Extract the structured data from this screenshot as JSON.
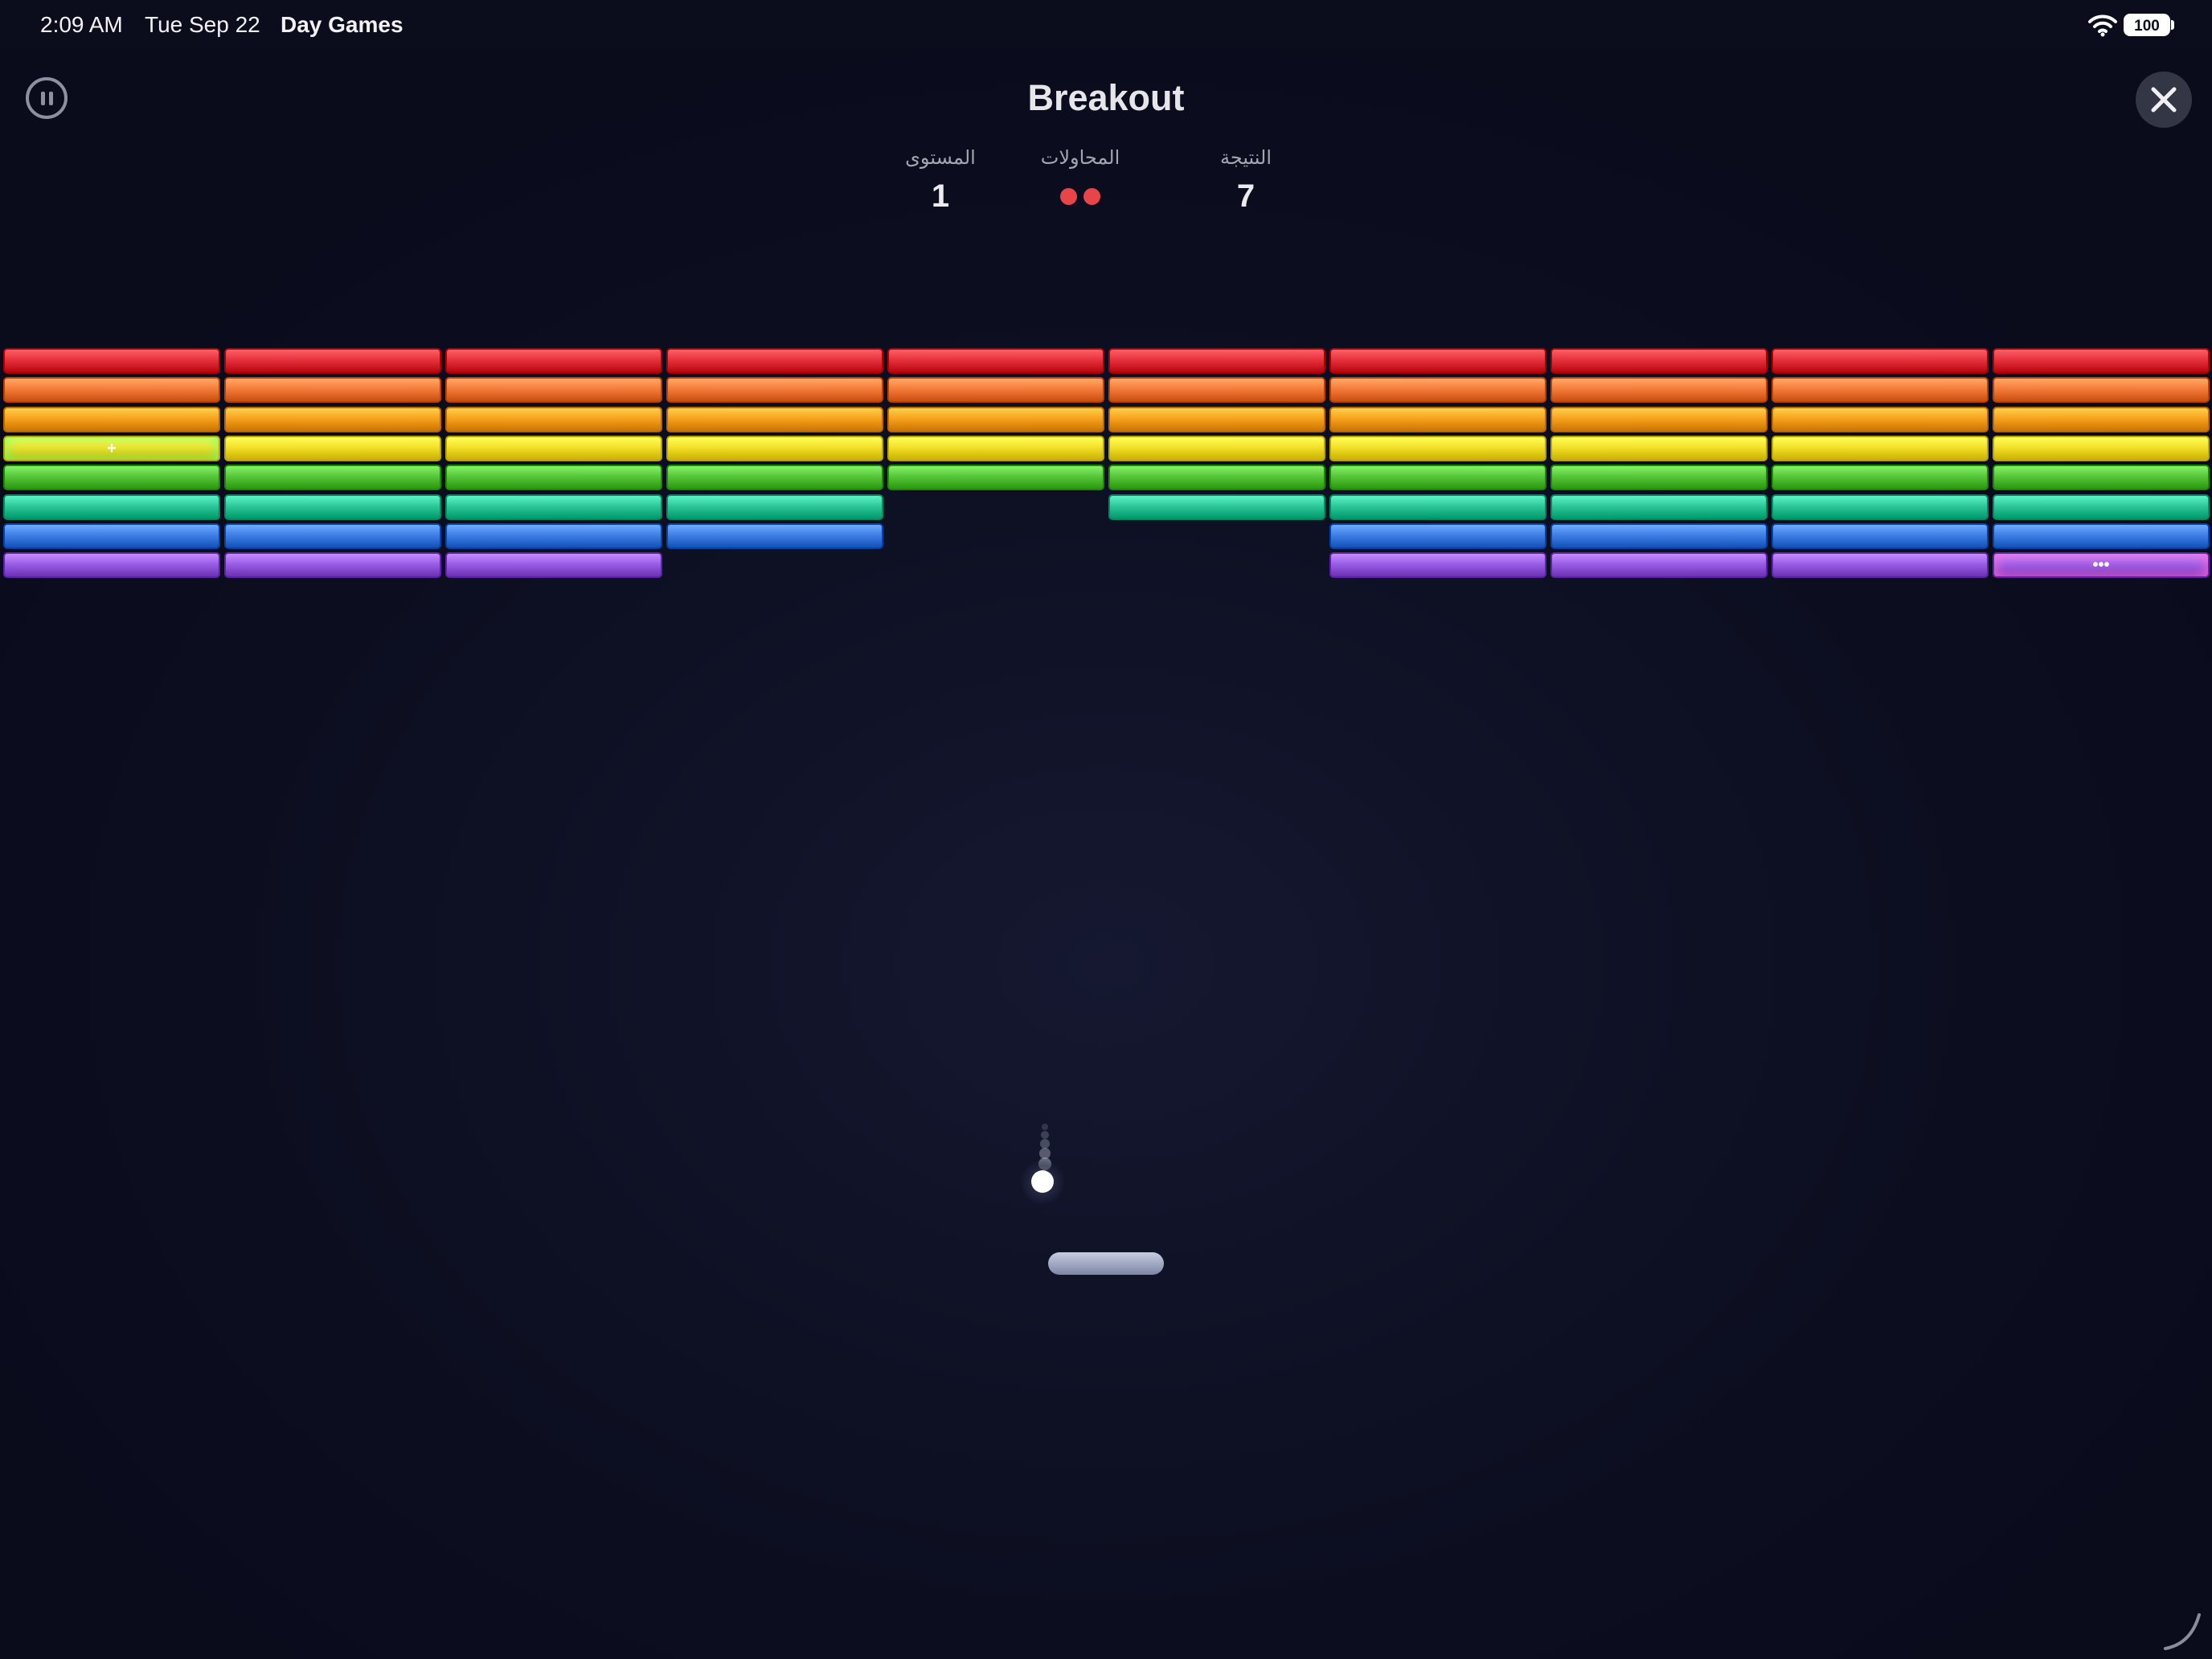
{
  "status_bar": {
    "time": "2:09 AM",
    "date": "Tue Sep 22",
    "app_name": "Day Games",
    "battery": "100"
  },
  "header": {
    "title": "Breakout"
  },
  "stats": {
    "level_label": "المستوى",
    "level_value": "1",
    "attempts_label": "المحاولات",
    "attempts_remaining": 2,
    "score_label": "النتيجة",
    "score_value": "7"
  },
  "board": {
    "columns": 10,
    "row_colors": [
      "#e6323c",
      "#f57c3a",
      "#f7a21e",
      "#f4e02a",
      "#58c63a",
      "#2ec79a",
      "#3f7fe6",
      "#9a5ee6"
    ],
    "missing_bricks": [
      {
        "row": 5,
        "col": 4
      },
      {
        "row": 6,
        "col": 4
      },
      {
        "row": 6,
        "col": 5
      },
      {
        "row": 7,
        "col": 3
      },
      {
        "row": 7,
        "col": 4
      },
      {
        "row": 7,
        "col": 5
      }
    ],
    "special_bricks": [
      {
        "row": 3,
        "col": 0,
        "symbol": "+",
        "glow": "#7dff6a"
      },
      {
        "row": 7,
        "col": 9,
        "symbol": "•••",
        "glow": "#ff6ad8"
      }
    ]
  },
  "icons": {
    "pause": "pause-icon",
    "close": "close-icon",
    "wifi": "wifi-icon",
    "battery": "battery-icon"
  }
}
